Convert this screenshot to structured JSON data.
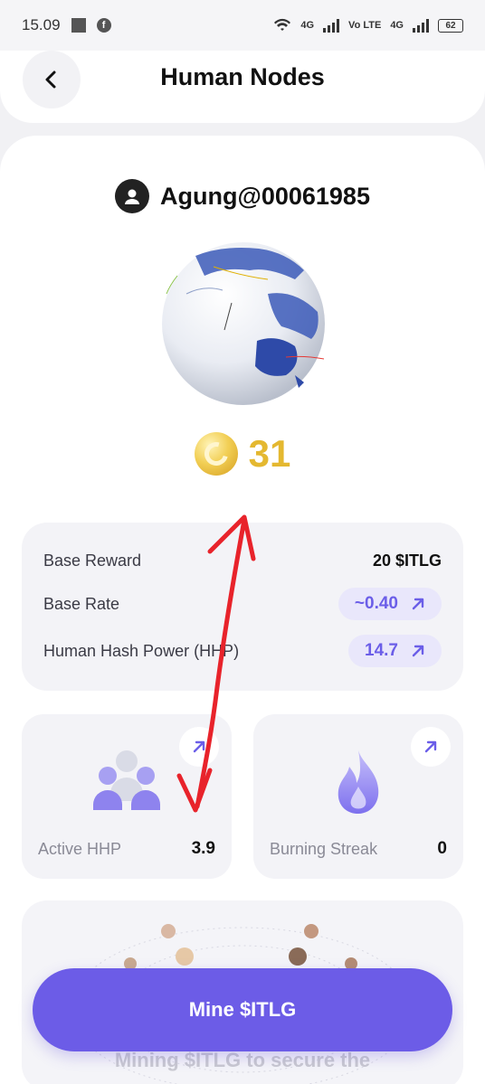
{
  "status_bar": {
    "time": "15.09",
    "net1": "4G",
    "volte": "Vo LTE",
    "net2": "4G",
    "battery": "62"
  },
  "header": {
    "title": "Human Nodes",
    "back_icon": "chevron-left-icon"
  },
  "profile": {
    "username": "Agung@00061985",
    "avatar_icon": "user-icon"
  },
  "token": {
    "balance": "31",
    "icon": "coin-icon"
  },
  "stats": {
    "rows": [
      {
        "label": "Base Reward",
        "value": "20 $ITLG"
      },
      {
        "label": "Base Rate",
        "value": "~0.40"
      },
      {
        "label": "Human Hash Power (HHP)",
        "value": "14.7"
      }
    ],
    "arrow_icon": "arrow-up-right-icon"
  },
  "cards": {
    "active_hhp": {
      "label": "Active HHP",
      "value": "3.9",
      "icon": "people-icon"
    },
    "burning_streak": {
      "label": "Burning Streak",
      "value": "0",
      "icon": "flame-icon"
    }
  },
  "promo": {
    "text": "Mining $ITLG to secure the"
  },
  "cta": {
    "label": "Mine $ITLG"
  },
  "colors": {
    "accent": "#6c5ce7",
    "token": "#e4b830",
    "annotation": "#e8232b"
  }
}
